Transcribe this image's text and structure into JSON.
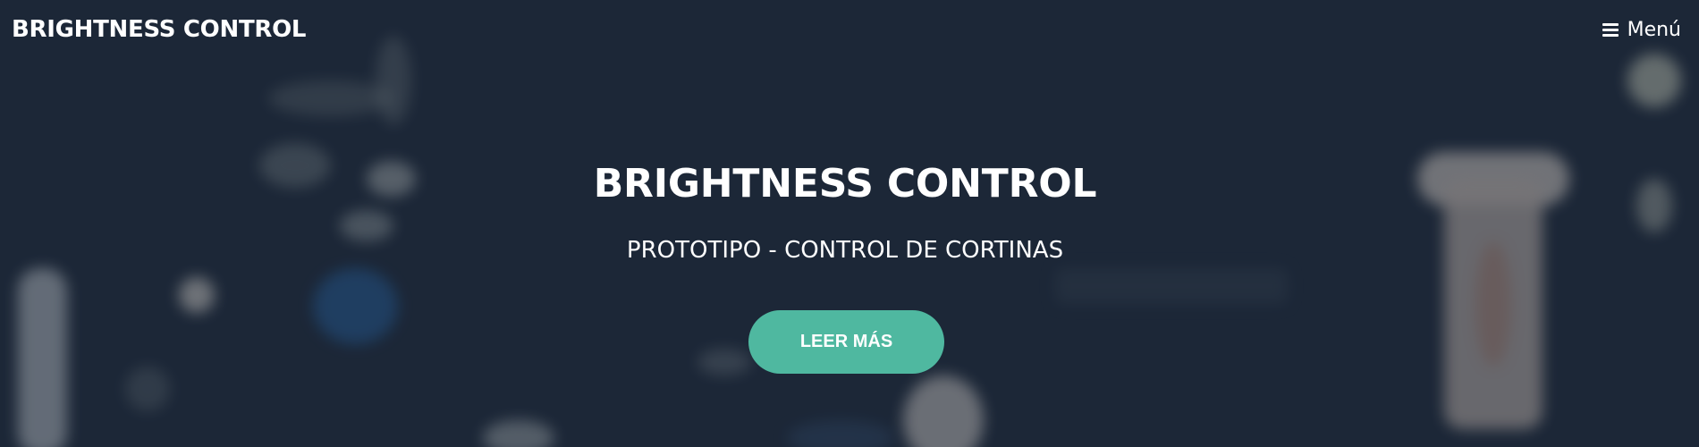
{
  "navbar": {
    "brand": "BRIGHTNESS CONTROL",
    "menu_label": "Menú",
    "menu_icon": "hamburger-icon"
  },
  "hero": {
    "title": "BRIGHTNESS CONTROL",
    "subtitle": "PROTOTIPO - CONTROL DE CORTINAS",
    "cta_label": "LEER MÁS"
  },
  "colors": {
    "overlay": "#1a2434",
    "accent": "#4fb8a0",
    "text": "#ffffff"
  }
}
